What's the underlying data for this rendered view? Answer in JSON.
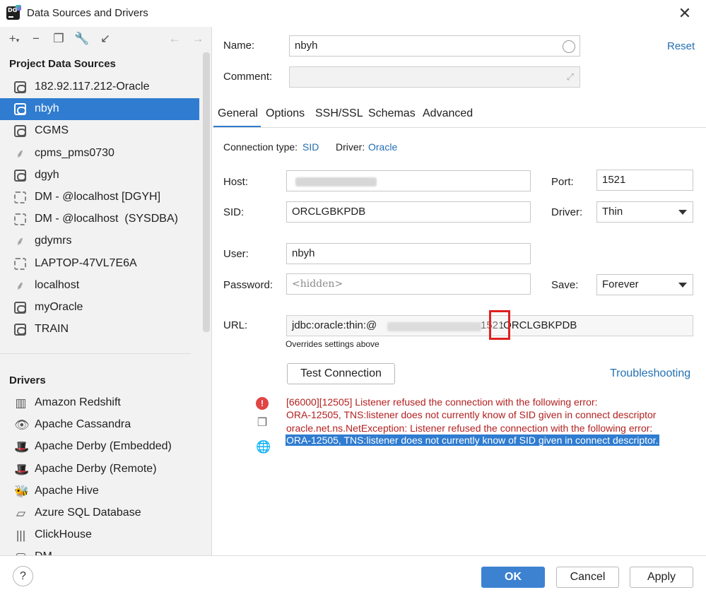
{
  "window": {
    "title": "Data Sources and Drivers"
  },
  "left": {
    "project_header": "Project Data Sources",
    "data_sources": [
      {
        "label": "182.92.117.212-Oracle",
        "icon": "oracle-icon"
      },
      {
        "label": "nbyh",
        "icon": "oracle-icon",
        "selected": true
      },
      {
        "label": "CGMS",
        "icon": "oracle-icon"
      },
      {
        "label": "cpms_pms0730",
        "icon": "mysql-icon"
      },
      {
        "label": "dgyh",
        "icon": "oracle-icon"
      },
      {
        "label": "DM - @localhost [DGYH]",
        "icon": "dm-icon"
      },
      {
        "label": "DM - @localhost  (SYSDBA)",
        "icon": "dm-icon"
      },
      {
        "label": "gdymrs",
        "icon": "mysql-icon"
      },
      {
        "label": "LAPTOP-47VL7E6A",
        "icon": "dm-icon"
      },
      {
        "label": "localhost",
        "icon": "mysql-icon"
      },
      {
        "label": "myOracle",
        "icon": "oracle-icon"
      },
      {
        "label": "TRAIN",
        "icon": "oracle-icon"
      }
    ],
    "drivers_header": "Drivers",
    "drivers": [
      {
        "label": "Amazon Redshift",
        "icon": "redshift-icon"
      },
      {
        "label": "Apache Cassandra",
        "icon": "cassandra-icon"
      },
      {
        "label": "Apache Derby (Embedded)",
        "icon": "derby-icon"
      },
      {
        "label": "Apache Derby (Remote)",
        "icon": "derby-icon"
      },
      {
        "label": "Apache Hive",
        "icon": "hive-icon"
      },
      {
        "label": "Azure SQL Database",
        "icon": "azure-icon"
      },
      {
        "label": "ClickHouse",
        "icon": "clickhouse-icon"
      },
      {
        "label": "DM",
        "icon": "dm-icon"
      }
    ]
  },
  "form": {
    "name_label": "Name:",
    "name_value": "nbyh",
    "reset": "Reset",
    "comment_label": "Comment:",
    "tabs": [
      "General",
      "Options",
      "SSH/SSL",
      "Schemas",
      "Advanced"
    ],
    "connection_type_label": "Connection type:",
    "connection_type_value": "SID",
    "driver_label_top": "Driver:",
    "driver_value_top": "Oracle",
    "host_label": "Host:",
    "port_label": "Port:",
    "port_value": "1521",
    "sid_label": "SID:",
    "sid_value": "ORCLGBKPDB",
    "driver_label": "Driver:",
    "driver_value": "Thin",
    "user_label": "User:",
    "user_value": "nbyh",
    "password_label": "Password:",
    "password_placeholder": "<hidden>",
    "save_label": "Save:",
    "save_value": "Forever",
    "url_label": "URL:",
    "url_prefix": "jdbc:oracle:thin:@",
    "url_suffix": ":ORCLGBKPDB",
    "url_port_visible": "1521",
    "url_hint": "Overrides settings above",
    "test_connection": "Test Connection",
    "troubleshooting": "Troubleshooting"
  },
  "errors": [
    "[66000][12505] Listener refused the connection with the following error:",
    "ORA-12505, TNS:listener does not currently know of SID given in connect descriptor",
    "oracle.net.ns.NetException: Listener refused the connection with the following error:",
    "ORA-12505, TNS:listener does not currently know of SID given in connect descriptor."
  ],
  "footer": {
    "help": "?",
    "ok": "OK",
    "cancel": "Cancel",
    "apply": "Apply"
  }
}
